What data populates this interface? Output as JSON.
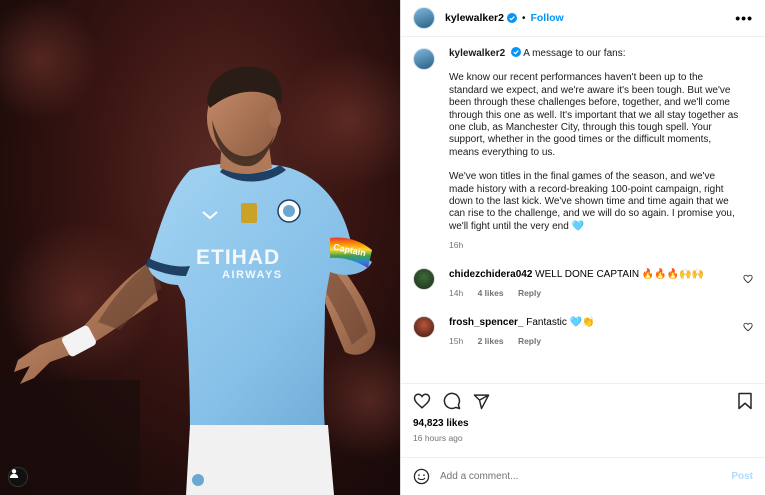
{
  "post": {
    "username": "kylewalker2",
    "follow_label": "Follow",
    "more_label": "•••"
  },
  "caption": {
    "username": "kylewalker2",
    "intro": "A message to our fans:",
    "para1": "We know our recent performances haven't been up to the standard we expect, and we're aware it's been tough. But we've been through these challenges before, together, and we'll come through this one as well. It's important that we all stay together as one club, as Manchester City, through this tough spell. Your support, whether in the good times or the difficult moments, means everything to us.",
    "para2": "We've won titles in the final games of the season, and we've made history with a record-breaking 100-point campaign, right down to the last kick. We've shown time and time again that we can rise to the challenge, and we will do so again. I promise you, we'll fight until the very end 🩵",
    "time": "16h"
  },
  "comments": [
    {
      "username": "chidezchidera042",
      "text": "WELL DONE CAPTAIN 🔥🔥🔥🙌🙌",
      "time": "14h",
      "likes": "4 likes",
      "reply": "Reply"
    },
    {
      "username": "frosh_spencer_",
      "text": "Fantastic 🩵👏",
      "time": "15h",
      "likes": "2 likes",
      "reply": "Reply"
    }
  ],
  "engagement": {
    "likes": "94,823 likes",
    "ago": "16 hours ago"
  },
  "composer": {
    "placeholder": "Add a comment...",
    "post_label": "Post"
  },
  "photo": {
    "shirt_sponsor": "ETIHAD",
    "shirt_sponsor_sub": "AIRWAYS",
    "armband": "Captain"
  },
  "colors": {
    "accent": "#0095f6",
    "verified": "#0095f6",
    "shirt": "#8cc4ea",
    "post_disabled": "#b3dbff"
  },
  "icons": {
    "like": "heart-icon",
    "comment": "comment-icon",
    "share": "share-icon",
    "save": "bookmark-icon",
    "emoji": "emoji-icon",
    "more": "more-icon",
    "verified": "verified-badge-icon",
    "tagged": "user-tag-icon"
  }
}
